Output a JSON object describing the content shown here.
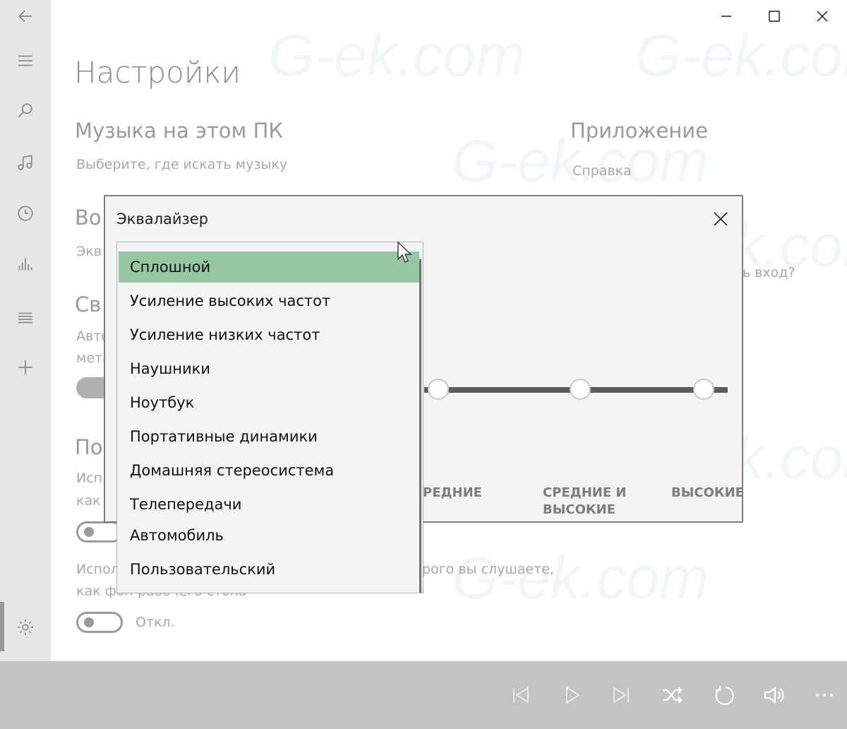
{
  "window": {
    "buttons": [
      "minimize-icon",
      "maximize-icon",
      "close-icon"
    ]
  },
  "rail": {
    "items": [
      "back-arrow-icon",
      "hamburger-menu-icon",
      "search-icon",
      "music-note-icon",
      "clock-icon",
      "equalizer-icon",
      "list-icon",
      "plus-icon",
      "gear-icon"
    ]
  },
  "page": {
    "title": "Настройки",
    "music_section": {
      "heading": "Музыка на этом ПК",
      "link": "Выберите, где искать музыку"
    },
    "app_section": {
      "heading": "Приложение",
      "link": "Справка",
      "partial_text": "ь вход?"
    },
    "partial_headings": {
      "playback": "Во",
      "playback_text": "Экв",
      "light": "Св",
      "light_text_1": "Авто",
      "light_text_2": "мета",
      "personal": "По",
      "personal_text_1": "Исп",
      "personal_text_2": "как"
    },
    "background_setting": {
      "text_line_1_left": "Испол",
      "text_line_1_right": "рого вы слушаете,",
      "text_line_2": "как фон рабочего стола",
      "toggle_label": "Откл."
    }
  },
  "dialog": {
    "title": "Эквалайзер",
    "band_labels": [
      "РЕДНИЕ",
      "СРЕДНИЕ И ВЫСОКИЕ",
      "ВЫСОКИЕ"
    ],
    "presets": [
      "Сплошной",
      "Усиление высоких частот",
      "Усиление низких частот",
      "Наушники",
      "Ноутбук",
      "Портативные динамики",
      "Домашняя стереосистема",
      "Телепередачи",
      "Автомобиль",
      "Пользовательский"
    ],
    "selected_preset": "Сплошной",
    "accent_color": "#95c7a3"
  },
  "player": {
    "controls": [
      "previous-icon",
      "play-icon",
      "next-icon",
      "shuffle-icon",
      "repeat-icon",
      "volume-icon",
      "more-icon"
    ]
  },
  "watermark": "G-ek.com"
}
